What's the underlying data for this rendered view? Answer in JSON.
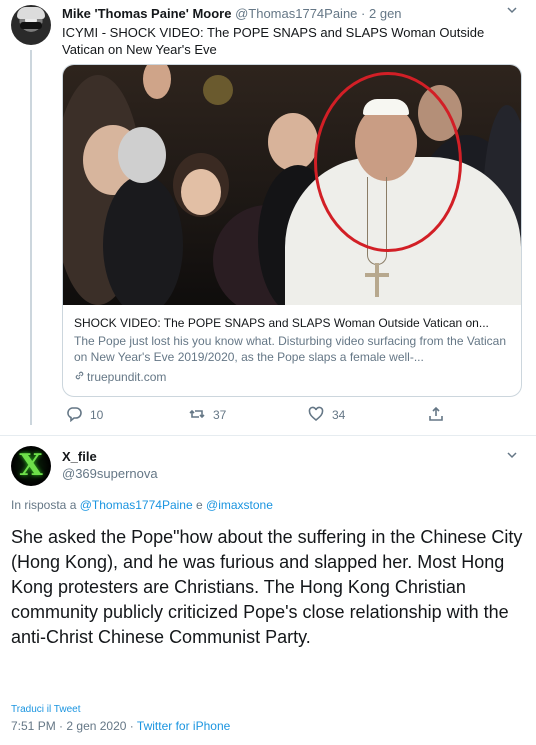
{
  "parent_tweet": {
    "author_name": "Mike 'Thomas Paine' Moore",
    "handle": "@Thomas1774Paine",
    "separator": "·",
    "time": "2 gen",
    "text": "ICYMI - SHOCK VIDEO: The POPE SNAPS and SLAPS Woman Outside Vatican on New Year's Eve",
    "card": {
      "title": "SHOCK VIDEO: The POPE SNAPS and SLAPS Woman Outside Vatican on...",
      "description": "The Pope just lost his you know what. Disturbing video surfacing from the Vatican on New Year's Eve 2019/2020, as the Pope slaps a female well-...",
      "domain": "truepundit.com"
    },
    "actions": {
      "reply_count": "10",
      "retweet_count": "37",
      "like_count": "34"
    }
  },
  "main_tweet": {
    "author_name": "X_file",
    "handle": "@369supernova",
    "reply_prefix": "In risposta a",
    "reply_mention_1": "@Thomas1774Paine",
    "reply_joiner": "e",
    "reply_mention_2": "@imaxstone",
    "text": "She asked the Pope\"how about the suffering in the Chinese City (Hong Kong), and he was furious and slapped her. Most Hong Kong protesters are Christians. The Hong Kong Christian community publicly criticized Pope's close relationship with the anti-Christ Chinese Communist Party.",
    "translate_label": "Traduci il Tweet",
    "time": "7:51 PM",
    "date": "2 gen 2020",
    "separator": "·",
    "source": "Twitter for iPhone"
  },
  "colors": {
    "link": "#1b95e0",
    "secondary_text": "#657786",
    "border": "#ccd6dd",
    "highlight_circle": "#d21f26"
  }
}
